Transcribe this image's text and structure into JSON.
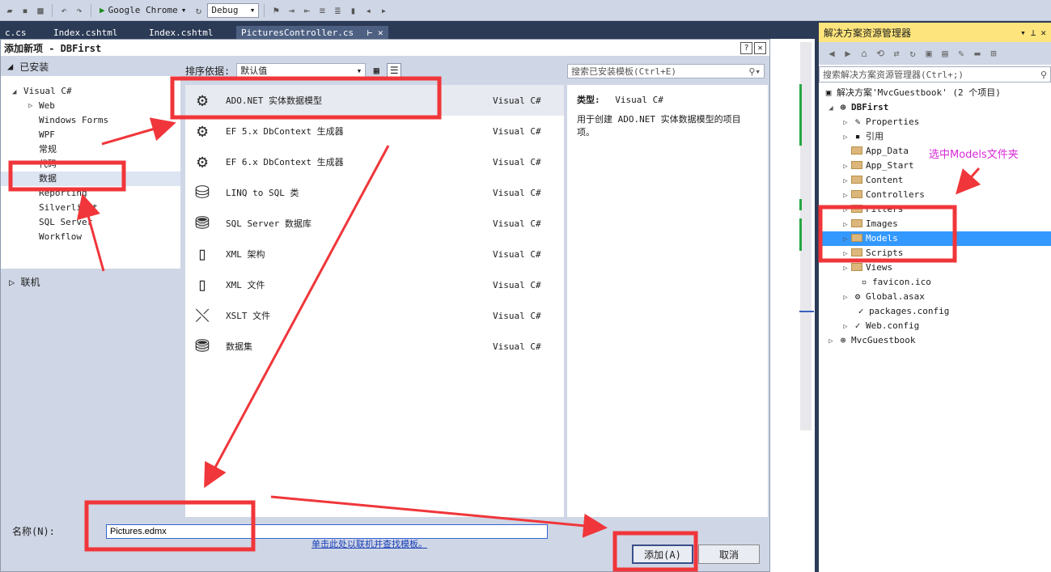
{
  "toolbar": {
    "browser_label": "Google Chrome",
    "config_value": "Debug"
  },
  "doc_tabs": [
    {
      "label": "c.cs"
    },
    {
      "label": "Index.cshtml"
    },
    {
      "label": "Index.cshtml"
    },
    {
      "label": "PicturesController.cs"
    }
  ],
  "dialog": {
    "title": "添加新项 - DBFirst",
    "installed_label": "已安装",
    "tree": [
      {
        "label": "Visual C#"
      },
      {
        "label": "Web"
      },
      {
        "label": "Windows Forms"
      },
      {
        "label": "WPF"
      },
      {
        "label": "常规"
      },
      {
        "label": "代码"
      },
      {
        "label": "数据"
      },
      {
        "label": "Reporting"
      },
      {
        "label": "Silverlight"
      },
      {
        "label": "SQL Server"
      },
      {
        "label": "Workflow"
      }
    ],
    "online_label": "联机",
    "sort_label": "排序依据:",
    "sort_value": "默认值",
    "search_placeholder": "搜索已安装模板(Ctrl+E)",
    "items": [
      {
        "name": "ADO.NET 实体数据模型",
        "lang": "Visual C#",
        "icon": "entity-model-icon"
      },
      {
        "name": "EF 5.x DbContext 生成器",
        "lang": "Visual C#",
        "icon": "dbcontext-generator-icon"
      },
      {
        "name": "EF 6.x DbContext 生成器",
        "lang": "Visual C#",
        "icon": "dbcontext-generator-icon"
      },
      {
        "name": "LINQ to SQL 类",
        "lang": "Visual C#",
        "icon": "linq-to-sql-icon"
      },
      {
        "name": "SQL Server 数据库",
        "lang": "Visual C#",
        "icon": "database-icon"
      },
      {
        "name": "XML 架构",
        "lang": "Visual C#",
        "icon": "xml-schema-icon"
      },
      {
        "name": "XML 文件",
        "lang": "Visual C#",
        "icon": "xml-file-icon"
      },
      {
        "name": "XSLT 文件",
        "lang": "Visual C#",
        "icon": "xslt-file-icon"
      },
      {
        "name": "数据集",
        "lang": "Visual C#",
        "icon": "dataset-icon"
      }
    ],
    "online_link": "单击此处以联机并查找模板。",
    "detail": {
      "type_label": "类型:",
      "type_value": "Visual C#",
      "description": "用于创建 ADO.NET 实体数据模型的项目项。"
    },
    "name_label": "名称(N):",
    "name_value": "Pictures.edmx",
    "add_button": "添加(A)",
    "cancel_button": "取消"
  },
  "solution_explorer": {
    "title": "解决方案资源管理器",
    "search_placeholder": "搜索解决方案资源管理器(Ctrl+;)",
    "annotation": "选中Models文件夹",
    "tree": [
      {
        "label": "解决方案'MvcGuestbook' (2 个项目)"
      },
      {
        "label": "DBFirst"
      },
      {
        "label": "Properties"
      },
      {
        "label": "引用"
      },
      {
        "label": "App_Data"
      },
      {
        "label": "App_Start"
      },
      {
        "label": "Content"
      },
      {
        "label": "Controllers"
      },
      {
        "label": "Filters"
      },
      {
        "label": "Images"
      },
      {
        "label": "Models"
      },
      {
        "label": "Scripts"
      },
      {
        "label": "Views"
      },
      {
        "label": "favicon.ico"
      },
      {
        "label": "Global.asax"
      },
      {
        "label": "packages.config"
      },
      {
        "label": "Web.config"
      },
      {
        "label": "MvcGuestbook"
      }
    ]
  },
  "colors": {
    "annotation_red": "#f0363a",
    "annotation_magenta": "#d82ad8",
    "selection_blue": "#3399ff",
    "title_yellow": "#fde47c"
  }
}
